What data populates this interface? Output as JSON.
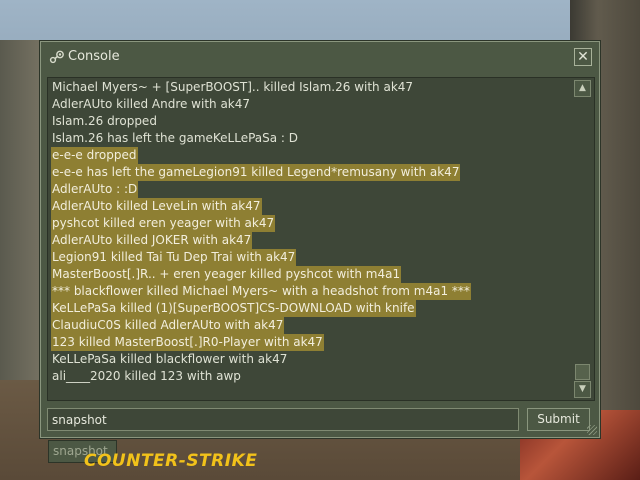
{
  "window": {
    "title": "Console",
    "title_icon": "steam-icon",
    "close_glyph": "✕"
  },
  "log": {
    "lines": [
      {
        "text": "Michael Myers~ + [SuperBOOST].. killed Islam.26 with ak47",
        "highlight": false
      },
      {
        "text": "AdlerAUto killed Andre with ak47",
        "highlight": false
      },
      {
        "text": "Islam.26 dropped",
        "highlight": false
      },
      {
        "text": "Islam.26 has left the gameKeLLePaSa : D",
        "highlight": false
      },
      {
        "text": "e-e-e dropped",
        "highlight": true
      },
      {
        "text": "e-e-e has left the gameLegion91 killed Legend*remusany with ak47",
        "highlight": true
      },
      {
        "text": "AdlerAUto : :D",
        "highlight": true
      },
      {
        "text": "AdlerAUto killed LeveLin with ak47",
        "highlight": true
      },
      {
        "text": "pyshcot killed eren yeager with ak47",
        "highlight": true
      },
      {
        "text": "AdlerAUto killed JOKER with ak47",
        "highlight": true
      },
      {
        "text": "Legion91 killed Tai Tu Dep Trai with ak47",
        "highlight": true
      },
      {
        "text": "MasterBoost[.]R.. + eren yeager killed pyshcot with m4a1",
        "highlight": true
      },
      {
        "text": "*** blackflower killed Michael Myers~ with a headshot from m4a1 ***",
        "highlight": true
      },
      {
        "text": "KeLLePaSa killed (1)[SuperBOOST]CS-DOWNLOAD with knife",
        "highlight": true
      },
      {
        "text": "ClaudiuC0S killed AdlerAUto with ak47",
        "highlight": true
      },
      {
        "text": "123 killed MasterBoost[.]R0-Player with ak47",
        "highlight": true
      },
      {
        "text": "KeLLePaSa killed blackflower with ak47",
        "highlight": false
      },
      {
        "text": "ali____2020 killed 123 with awp",
        "highlight": false
      }
    ],
    "highlight_color": "#8e7f33",
    "scroll_up_glyph": "▲",
    "scroll_down_glyph": "▼"
  },
  "command": {
    "value": "snapshot",
    "submit_label": "Submit",
    "autocomplete_suggestion": "snapshot"
  },
  "logo": {
    "text": "COUNTER-STRIKE",
    "brand_color": "#f2c21a"
  },
  "colors": {
    "window_bg": "#4c5844",
    "text": "#dfe2d4"
  }
}
